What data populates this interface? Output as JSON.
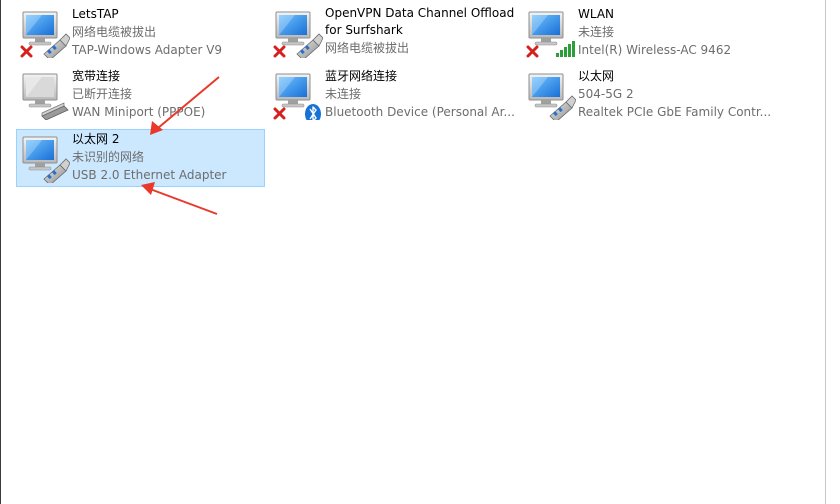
{
  "adapters": [
    {
      "name": "LetsTAP",
      "status": "网络电缆被拔出",
      "device": "TAP-Windows Adapter V9",
      "icon": "network-adapter-disconnected-icon"
    },
    {
      "name_line1": "OpenVPN Data Channel Offload",
      "name_line2": "for Surfshark",
      "status": "网络电缆被拔出",
      "icon": "network-adapter-disconnected-icon"
    },
    {
      "name": "WLAN",
      "status": "未连接",
      "device": "Intel(R) Wireless-AC 9462",
      "icon": "wifi-adapter-disconnected-icon"
    },
    {
      "name": "宽带连接",
      "status": "已断开连接",
      "device": "WAN Miniport (PPPOE)",
      "icon": "broadband-modem-icon"
    },
    {
      "name": "蓝牙网络连接",
      "status": "未连接",
      "device": "Bluetooth Device (Personal Ar...",
      "icon": "bluetooth-adapter-disconnected-icon"
    },
    {
      "name": "以太网",
      "status": "504-5G 2",
      "device": "Realtek PCIe GbE Family Contr...",
      "icon": "ethernet-adapter-icon"
    },
    {
      "name": "以太网 2",
      "status": "未识别的网络",
      "device": "USB 2.0 Ethernet Adapter",
      "icon": "ethernet-adapter-icon",
      "selected": true
    }
  ],
  "colors": {
    "selected_bg": "#cce8ff",
    "selected_border": "#99d1ff",
    "annotation_arrow": "#e8392b",
    "error_x": "#d6201c",
    "signal_green": "#2e9e3a"
  }
}
